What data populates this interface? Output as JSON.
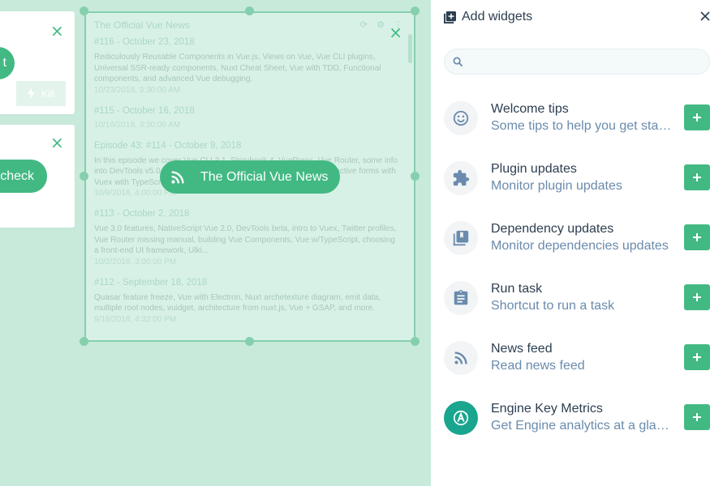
{
  "dashboard": {
    "card1_button_fragment": "t",
    "card1_kill_label": "Kill",
    "card2_button_label": "check",
    "news": {
      "faint_title": "The Official Vue News",
      "pill_label": "The Official Vue News",
      "items": [
        {
          "title": "#116 - October 23, 2018",
          "desc": "Rediculously Reusable Components in Vue.js, Views on Vue, Vue CLI plugins, Universal SSR-ready components, Nuxt Cheat Sheet, Vue with TDD, Functional components, and advanced Vue debugging.",
          "date": "10/23/2018, 3:30:00 AM"
        },
        {
          "title": "#115 - October 16, 2018",
          "desc": "",
          "date": "10/16/2018, 3:30:00 AM"
        },
        {
          "title": "Episode 43: #114 - October 9, 2018",
          "desc": "In this episode we cover Vue CLI 3.1, Storybook 4, VuePress, Vue Router, some info into DevTools v5.0, unit testing, component library, Vuetify, Vuex, reactive forms with Vuex with TypeScript, and Tidelift, etc.",
          "date": "10/9/2018, 4:00:00 PM"
        },
        {
          "title": "#113 - October 2, 2018",
          "desc": "Vue 3.0 features, NativeScript Vue 2.0, DevTools beta, intro to Vuex, Twitter profiles, Vue Router missing manual, building Vue Components, Vue w/TypeScript, choosing a front-end UI framework, Ulki...",
          "date": "10/2/2018, 3:00:00 PM"
        },
        {
          "title": "#112 - September 18, 2018",
          "desc": "Quasar feature freeze, Vue with Electron, Nuxt archetexture diagram, emit data, multiple root nodes, vuidget, architecture from nuxt.js, Vue + GSAP, and more.",
          "date": "9/18/2018, 4:32:00 PM"
        }
      ]
    }
  },
  "panel": {
    "title": "Add widgets",
    "search": {
      "value": "",
      "placeholder": ""
    },
    "widgets": [
      {
        "name": "Welcome tips",
        "description": "Some tips to help you get started",
        "icon": "smiley-icon"
      },
      {
        "name": "Plugin updates",
        "description": "Monitor plugin updates",
        "icon": "puzzle-icon"
      },
      {
        "name": "Dependency updates",
        "description": "Monitor dependencies updates",
        "icon": "library-icon"
      },
      {
        "name": "Run task",
        "description": "Shortcut to run a task",
        "icon": "clipboard-icon"
      },
      {
        "name": "News feed",
        "description": "Read news feed",
        "icon": "rss-icon"
      },
      {
        "name": "Engine Key Metrics",
        "description": "Get Engine analytics at a glance",
        "icon": "apollo-engine-icon"
      }
    ]
  },
  "colors": {
    "accent": "#42b983",
    "dashboard_bg": "#c8eadb",
    "text_primary": "#2c3e50",
    "text_secondary": "#6a8bad",
    "engine_badge": "#1aa58e"
  }
}
